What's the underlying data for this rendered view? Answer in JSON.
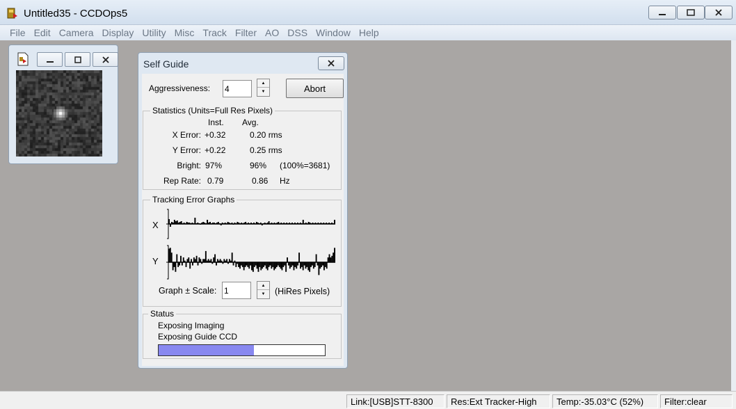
{
  "window": {
    "title": "Untitled35 - CCDOps5",
    "icon": "ccdops-app-icon"
  },
  "menu": [
    "File",
    "Edit",
    "Camera",
    "Display",
    "Utility",
    "Misc",
    "Track",
    "Filter",
    "AO",
    "DSS",
    "Window",
    "Help"
  ],
  "image_window": {
    "icon": "image-document-icon"
  },
  "self_guide": {
    "title": "Self Guide",
    "aggressiveness_label": "Aggressiveness:",
    "aggressiveness_value": "4",
    "abort_label": "Abort",
    "statistics": {
      "group_title": "Statistics (Units=Full Res Pixels)",
      "col_inst": "Inst.",
      "col_avg": "Avg.",
      "rows": [
        {
          "label": "X Error:",
          "inst": "+0.32",
          "avg": "0.20 rms",
          "extra": ""
        },
        {
          "label": "Y Error:",
          "inst": "+0.22",
          "avg": "0.25 rms",
          "extra": ""
        },
        {
          "label": "Bright:",
          "inst": "97%",
          "avg": "96%",
          "extra": "(100%=3681)"
        },
        {
          "label": "Rep Rate:",
          "inst": "0.79",
          "avg": "0.86",
          "extra": "Hz"
        }
      ]
    },
    "graphs": {
      "group_title": "Tracking Error Graphs",
      "x_label": "X",
      "y_label": "Y",
      "scale_label": "Graph ± Scale:",
      "scale_value": "1",
      "scale_units": "(HiRes Pixels)",
      "x_errors": [
        0.35,
        -0.2,
        0.15,
        0.1,
        0.3,
        0.2,
        0.25,
        0.1,
        0.15,
        0.2,
        0.05,
        0.1,
        0.05,
        0.15,
        0.1,
        0.1,
        0.05,
        0.1,
        0.05,
        0.45,
        0.05,
        0.1,
        0.05,
        -0.05,
        0.1,
        0.15,
        0.1,
        0.05,
        0.3,
        0.1,
        0.15,
        0.05,
        0.1,
        0.1,
        0.05,
        0.1,
        0.15,
        0.05,
        -0.1,
        0.1,
        0.05,
        0.1,
        0.05,
        0.15,
        0.1,
        0.05,
        0.1,
        -0.05,
        0.1,
        0.05,
        0.15,
        0.1,
        0.05,
        0.1,
        0.05,
        0.1,
        0.15,
        0.05,
        0.1,
        0.05,
        0.1,
        0.05,
        0.1,
        0.05,
        0.15,
        0.1,
        0.05,
        0.1,
        -0.1,
        0.05,
        0.1,
        0.05,
        0.1,
        0.2,
        0.05,
        0.1,
        0.05,
        0.1,
        0.05,
        0.1,
        0.15,
        0.05,
        0.1,
        0.05,
        0.1,
        0.05,
        0.1,
        0.05,
        0.1,
        0.05,
        0.1,
        0.05,
        0.1,
        0.05,
        0.1,
        0.05,
        0.1,
        0.05,
        0.3,
        0.05,
        0.1,
        0.05,
        0.15,
        0.1,
        0.05,
        0.1,
        0.05,
        0.1,
        0.05,
        0.1,
        0.05,
        0.1,
        0.05,
        0.1,
        0.05,
        0.1,
        0.05,
        0.1,
        0.05,
        0.1,
        0.05,
        0.3
      ],
      "y_errors": [
        0.85,
        0.9,
        0.6,
        -0.5,
        -0.3,
        -0.6,
        0.5,
        -0.3,
        -0.2,
        0.4,
        -0.2,
        0.3,
        0.1,
        -0.3,
        0.2,
        0.3,
        -0.4,
        0.2,
        -0.2,
        0.3,
        0.2,
        0.4,
        -0.2,
        0.3,
        0.2,
        -0.1,
        0.2,
        0.2,
        0.7,
        0.1,
        0.2,
        0.1,
        0.2,
        -0.1,
        0.3,
        0.5,
        -0.2,
        0.2,
        0.1,
        0.2,
        0.1,
        -0.1,
        0.2,
        0.1,
        0.2,
        -0.1,
        0.2,
        0.1,
        0.6,
        -0.2,
        0.1,
        -0.3,
        -0.1,
        -0.3,
        -0.4,
        -0.2,
        -0.3,
        -0.5,
        -0.3,
        -0.2,
        -0.3,
        -0.4,
        -0.2,
        -0.5,
        -0.6,
        -0.3,
        -0.2,
        -0.4,
        -0.6,
        -0.3,
        -0.5,
        -0.4,
        -0.3,
        -0.2,
        -0.4,
        -0.5,
        -0.3,
        -0.2,
        -0.4,
        -0.3,
        -0.5,
        -0.4,
        -0.3,
        -0.2,
        -0.3,
        -0.4,
        -0.5,
        -0.3,
        -0.2,
        -0.6,
        0.3,
        -0.2,
        -0.4,
        -0.3,
        -0.2,
        -0.5,
        -0.3,
        -0.4,
        -0.2,
        0.6,
        -0.4,
        -0.3,
        -0.5,
        -0.2,
        -0.4,
        -0.3,
        -0.5,
        -0.6,
        -0.3,
        -0.2,
        -0.4,
        -0.3,
        0.5,
        -0.2,
        -0.8,
        -0.4,
        -0.3,
        -0.2,
        -0.5,
        -0.3,
        -0.4,
        0.3,
        0.5,
        0.3,
        0.4,
        0.6,
        0.9
      ]
    },
    "status": {
      "group_title": "Status",
      "line1": "Exposing Imaging",
      "line2": "Exposing Guide CCD",
      "progress": 0.575,
      "progress_color": "#8888f0"
    }
  },
  "statusbar": {
    "link": "Link:[USB]STT-8300",
    "res": "Res:Ext Tracker-High",
    "temp": "Temp:-35.03°C (52%)",
    "filter": "Filter:clear"
  }
}
